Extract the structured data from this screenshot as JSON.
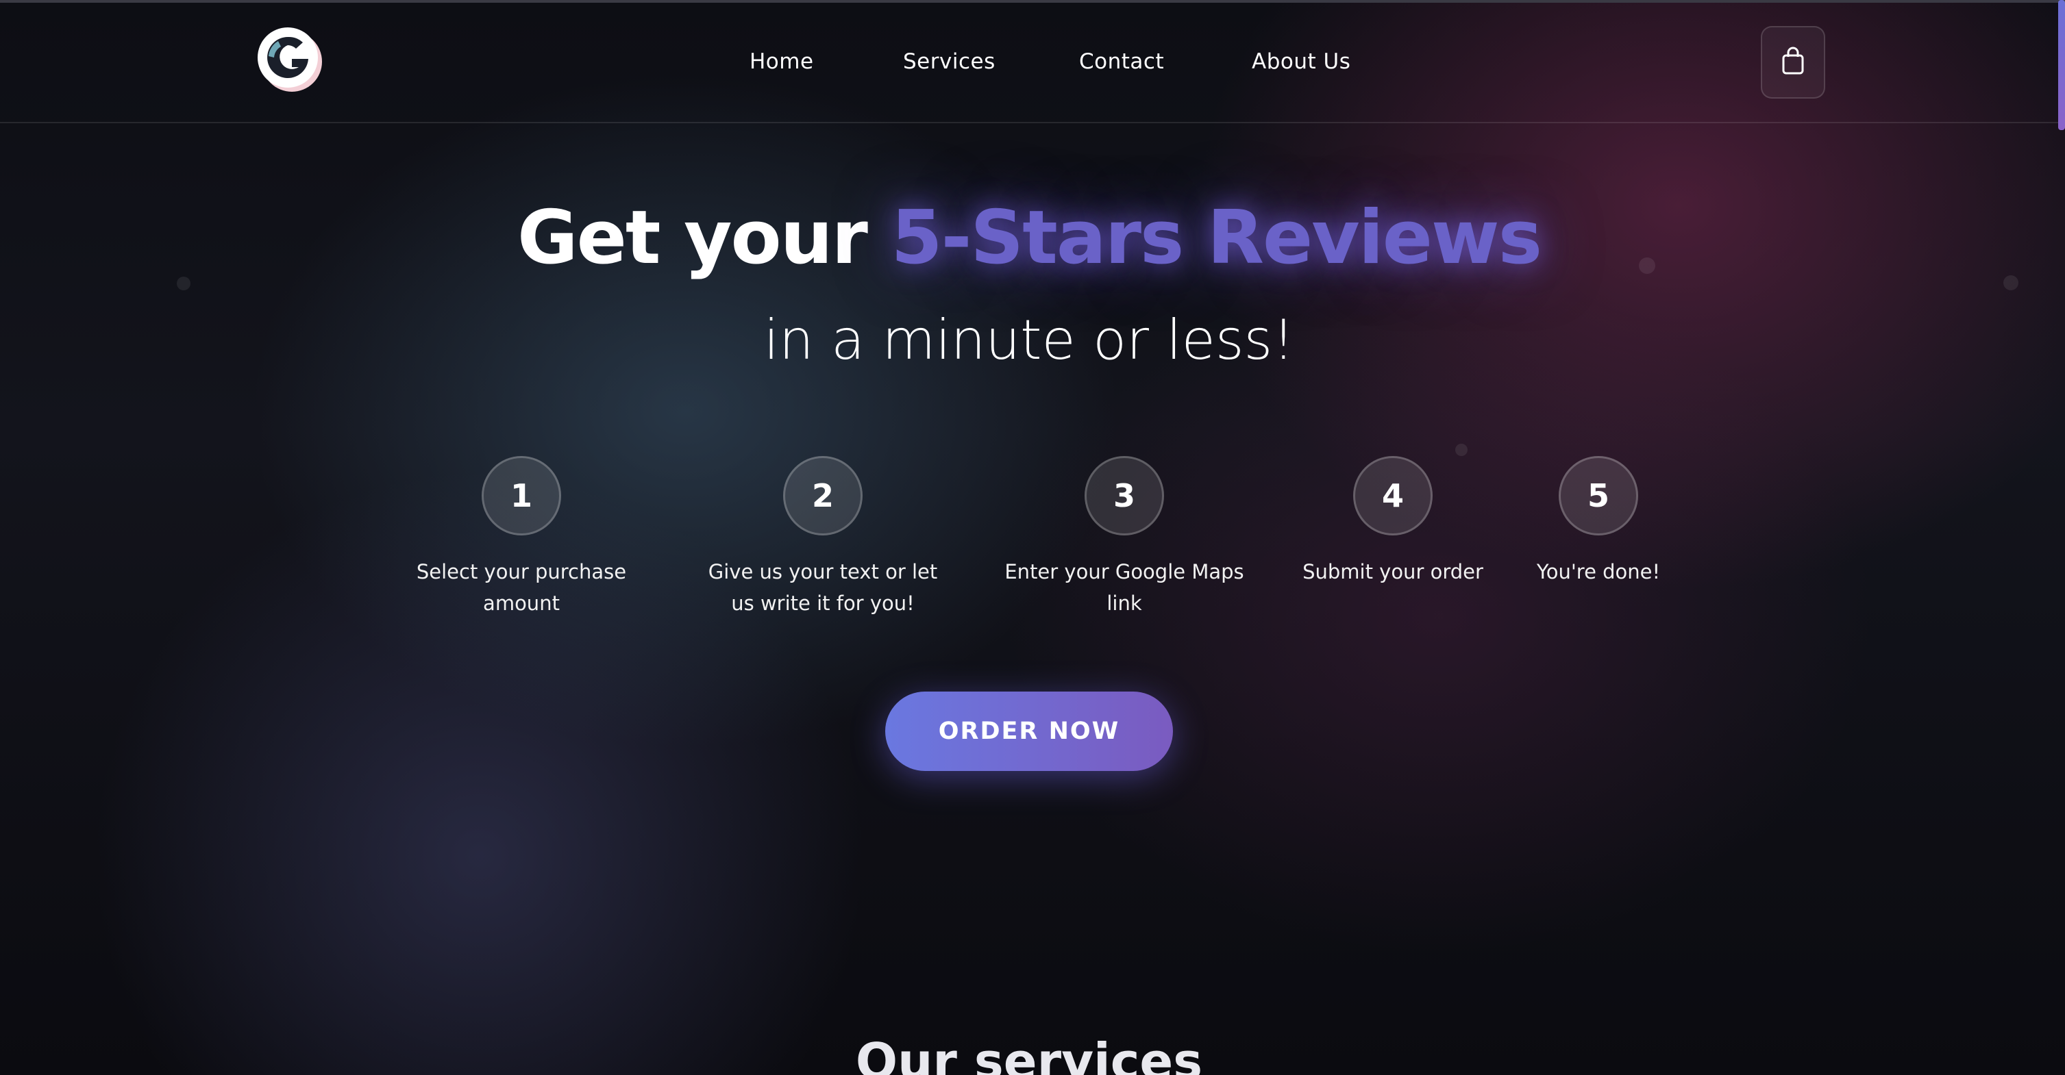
{
  "header": {
    "logo_letter": "G",
    "nav": [
      {
        "label": "Home"
      },
      {
        "label": "Services"
      },
      {
        "label": "Contact"
      },
      {
        "label": "About Us"
      }
    ],
    "cart_icon": "shopping-bag-icon"
  },
  "hero": {
    "title_plain": "Get your ",
    "title_accent": "5-Stars Reviews",
    "subtitle": "in a minute or less!",
    "accent_color": "#6a62c8"
  },
  "steps": [
    {
      "number": "1",
      "label": "Select your purchase amount"
    },
    {
      "number": "2",
      "label": "Give us your text or let us write it for you!"
    },
    {
      "number": "3",
      "label": "Enter your Google Maps link"
    },
    {
      "number": "4",
      "label": "Submit your order"
    },
    {
      "number": "5",
      "label": "You're done!"
    }
  ],
  "cta": {
    "label": "ORDER NOW",
    "gradient": [
      "#6a78e0",
      "#7a5bc0"
    ]
  },
  "services": {
    "heading": "Our services"
  }
}
